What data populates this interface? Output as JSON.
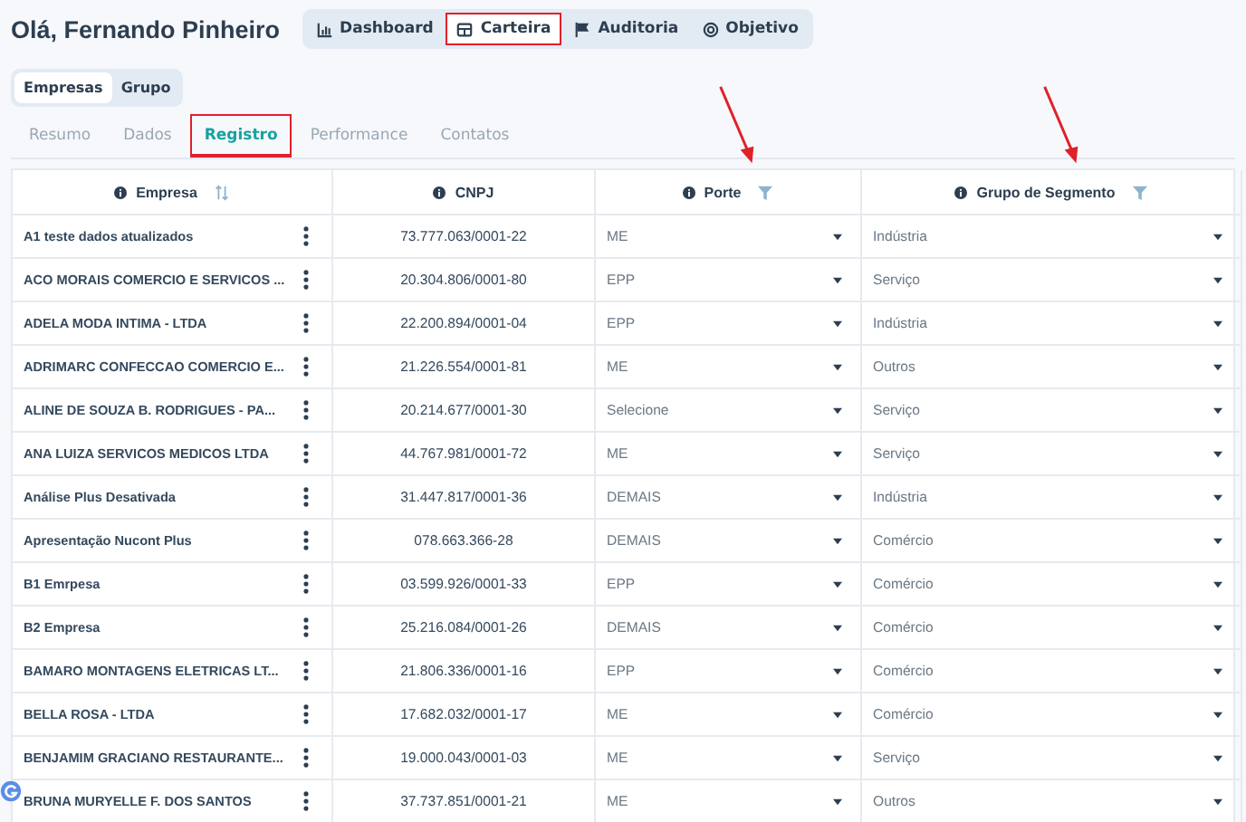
{
  "greeting": "Olá, Fernando Pinheiro",
  "nav": [
    {
      "label": "Dashboard",
      "selected": false,
      "highlighted": false
    },
    {
      "label": "Carteira",
      "selected": true,
      "highlighted": true
    },
    {
      "label": "Auditoria",
      "selected": false,
      "highlighted": false
    },
    {
      "label": "Objetivo",
      "selected": false,
      "highlighted": false
    }
  ],
  "view_toggle": [
    {
      "label": "Empresas",
      "selected": true
    },
    {
      "label": "Grupo",
      "selected": false
    }
  ],
  "tabs": [
    {
      "label": "Resumo",
      "selected": false,
      "highlighted": false
    },
    {
      "label": "Dados",
      "selected": false,
      "highlighted": false
    },
    {
      "label": "Registro",
      "selected": true,
      "highlighted": true
    },
    {
      "label": "Performance",
      "selected": false,
      "highlighted": false
    },
    {
      "label": "Contatos",
      "selected": false,
      "highlighted": false
    }
  ],
  "table": {
    "columns": [
      {
        "label": "Empresa",
        "marked": false
      },
      {
        "label": "CNPJ",
        "marked": false
      },
      {
        "label": "Porte",
        "marked": true
      },
      {
        "label": "Grupo de Segmento",
        "marked": true
      }
    ],
    "rows": [
      {
        "empresa": "A1 teste dados atualizados",
        "cnpj": "73.777.063/0001-22",
        "porte": "ME",
        "grupo": "Indústria"
      },
      {
        "empresa": "ACO MORAIS COMERCIO E SERVICOS ...",
        "cnpj": "20.304.806/0001-80",
        "porte": "EPP",
        "grupo": "Serviço"
      },
      {
        "empresa": "ADELA MODA INTIMA - LTDA",
        "cnpj": "22.200.894/0001-04",
        "porte": "EPP",
        "grupo": "Indústria"
      },
      {
        "empresa": "ADRIMARC CONFECCAO COMERCIO E...",
        "cnpj": "21.226.554/0001-81",
        "porte": "ME",
        "grupo": "Outros"
      },
      {
        "empresa": "ALINE DE SOUZA B. RODRIGUES - PA...",
        "cnpj": "20.214.677/0001-30",
        "porte": "Selecione",
        "grupo": "Serviço"
      },
      {
        "empresa": "ANA LUIZA SERVICOS MEDICOS LTDA",
        "cnpj": "44.767.981/0001-72",
        "porte": "ME",
        "grupo": "Serviço"
      },
      {
        "empresa": "Análise Plus Desativada",
        "cnpj": "31.447.817/0001-36",
        "porte": "DEMAIS",
        "grupo": "Indústria"
      },
      {
        "empresa": "Apresentação Nucont Plus",
        "cnpj": "078.663.366-28",
        "porte": "DEMAIS",
        "grupo": "Comércio"
      },
      {
        "empresa": "B1 Emrpesa",
        "cnpj": "03.599.926/0001-33",
        "porte": "EPP",
        "grupo": "Comércio"
      },
      {
        "empresa": "B2 Empresa",
        "cnpj": "25.216.084/0001-26",
        "porte": "DEMAIS",
        "grupo": "Comércio"
      },
      {
        "empresa": "BAMARO MONTAGENS ELETRICAS LT...",
        "cnpj": "21.806.336/0001-16",
        "porte": "EPP",
        "grupo": "Comércio"
      },
      {
        "empresa": "BELLA ROSA - LTDA",
        "cnpj": "17.682.032/0001-17",
        "porte": "ME",
        "grupo": "Comércio"
      },
      {
        "empresa": "BENJAMIM GRACIANO RESTAURANTE...",
        "cnpj": "19.000.043/0001-03",
        "porte": "ME",
        "grupo": "Serviço"
      },
      {
        "empresa": "BRUNA MURYELLE F. DOS SANTOS",
        "cnpj": "37.737.851/0001-21",
        "porte": "ME",
        "grupo": "Outros"
      }
    ]
  }
}
